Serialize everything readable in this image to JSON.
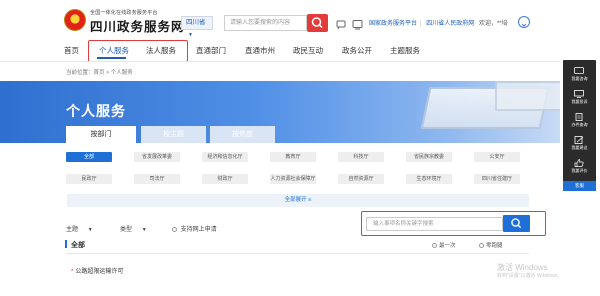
{
  "header": {
    "logo_subtitle": "全国一体化在线政务服务平台",
    "logo_title": "四川政务服务网",
    "region_label": "四川省",
    "search_placeholder": "请输入您要搜索的内容",
    "links": [
      "国家政务服务平台",
      "四川省人民政府网"
    ],
    "greeting": "欢迎，**培"
  },
  "nav": {
    "items": [
      "首页",
      "个人服务",
      "法人服务",
      "直通部门",
      "直通市州",
      "政民互动",
      "政务公开",
      "主题服务"
    ]
  },
  "breadcrumb": "当前位置：首页 > 个人服务",
  "banner": {
    "title": "个人服务"
  },
  "tabs": [
    "按部门",
    "按主题",
    "按热度"
  ],
  "departments": [
    [
      "全部",
      "省发展改革委",
      "经济和信息化厅",
      "教育厅",
      "科技厅",
      "省民族宗教委",
      "公安厅"
    ],
    [
      "民政厅",
      "司法厅",
      "财政厅",
      "人力资源社会保障厅",
      "自然资源厅",
      "生态环境厅",
      "四川省住建厅"
    ]
  ],
  "expand_label": "全部展开",
  "filters": {
    "theme_label": "主题",
    "type_label": "类型",
    "online_apply_label": "支持网上申请"
  },
  "search": {
    "placeholder": "输入事项名称关键字搜索"
  },
  "section": {
    "title": "全部",
    "sort_options": [
      "最一次",
      "零跑腿"
    ]
  },
  "results": [
    "公路超限运输许可"
  ],
  "watermark": {
    "line1": "激活 Windows",
    "line2": "转到\"设置\"以激活 Windows。"
  },
  "float_panel": {
    "items": [
      "我要咨询",
      "我要投诉",
      "办件查询",
      "我要建议",
      "我要评价"
    ],
    "top_label": "客服"
  },
  "colors": {
    "brand_blue": "#1e6fd6",
    "highlight_red": "#e23b3b",
    "banner_blue": "#2f6fcf"
  }
}
